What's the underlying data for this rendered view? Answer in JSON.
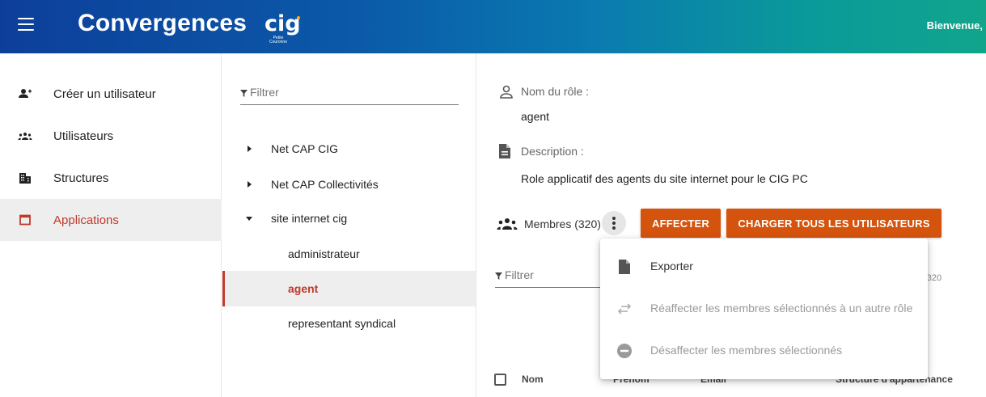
{
  "header": {
    "title": "Convergences",
    "logo_text": "cig",
    "logo_subtext": "Petite Couronne",
    "welcome": "Bienvenue,",
    "colors": {
      "gradient_start": "#0d3f9a",
      "gradient_end": "#11a58c"
    },
    "menu_icon": "hamburger-icon"
  },
  "sidebar": {
    "items": [
      {
        "label": "Créer un utilisateur",
        "icon": "add-user-icon",
        "active": false
      },
      {
        "label": "Utilisateurs",
        "icon": "users-icon",
        "active": false
      },
      {
        "label": "Structures",
        "icon": "building-icon",
        "active": false
      },
      {
        "label": "Applications",
        "icon": "window-icon",
        "active": true
      }
    ]
  },
  "tree": {
    "filter_placeholder": "Filtrer",
    "items": [
      {
        "label": "Net CAP CIG",
        "expanded": false
      },
      {
        "label": "Net CAP Collectivités",
        "expanded": false
      },
      {
        "label": "site internet cig",
        "expanded": true
      }
    ],
    "children": [
      {
        "label": "administrateur",
        "selected": false
      },
      {
        "label": "agent",
        "selected": true
      },
      {
        "label": "representant syndical",
        "selected": false
      }
    ]
  },
  "detail": {
    "role_name_label": "Nom du rôle :",
    "role_name_value": "agent",
    "description_label": "Description :",
    "description_value": "Role applicatif des agents du site internet pour le CIG PC",
    "members_label": "Membres (320)",
    "assign_button": "AFFECTER",
    "load_all_button": "CHARGER TOUS LES UTILISATEURS",
    "members_filter_placeholder": "Filtrer",
    "paging_text": "ır 320",
    "table_columns": [
      "Nom",
      "Prénom",
      "Email",
      "Structure d'appartenance"
    ]
  },
  "menu": {
    "items": [
      {
        "label": "Exporter",
        "icon": "file-icon",
        "disabled": false
      },
      {
        "label": "Réaffecter les membres sélectionnés à un autre rôle",
        "icon": "swap-icon",
        "disabled": true
      },
      {
        "label": "Désaffecter les membres sélectionnés",
        "icon": "minus-circle-icon",
        "disabled": true
      }
    ]
  },
  "colors": {
    "accent": "#c0392b",
    "button": "#d4530d"
  }
}
